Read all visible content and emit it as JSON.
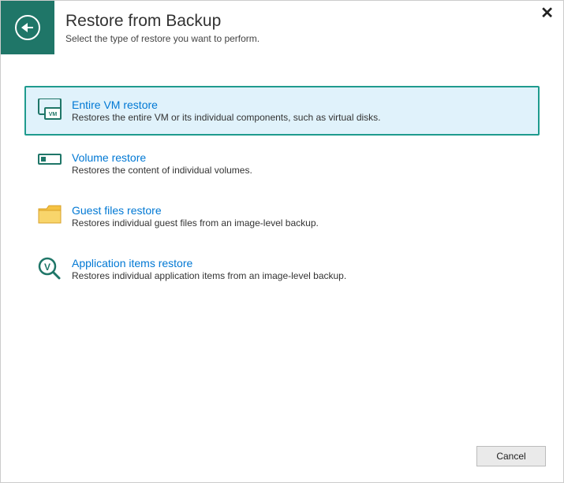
{
  "header": {
    "title": "Restore from Backup",
    "subtitle": "Select the type of restore you want to perform."
  },
  "options": {
    "vm": {
      "title": "Entire VM restore",
      "desc": "Restores the entire VM or its individual components, such as virtual disks."
    },
    "volume": {
      "title": "Volume restore",
      "desc": "Restores the content of individual volumes."
    },
    "guest": {
      "title": "Guest files restore",
      "desc": "Restores individual guest files from an image-level backup."
    },
    "app": {
      "title": "Application items restore",
      "desc": "Restores individual application items from an image-level backup."
    }
  },
  "footer": {
    "cancel": "Cancel"
  }
}
